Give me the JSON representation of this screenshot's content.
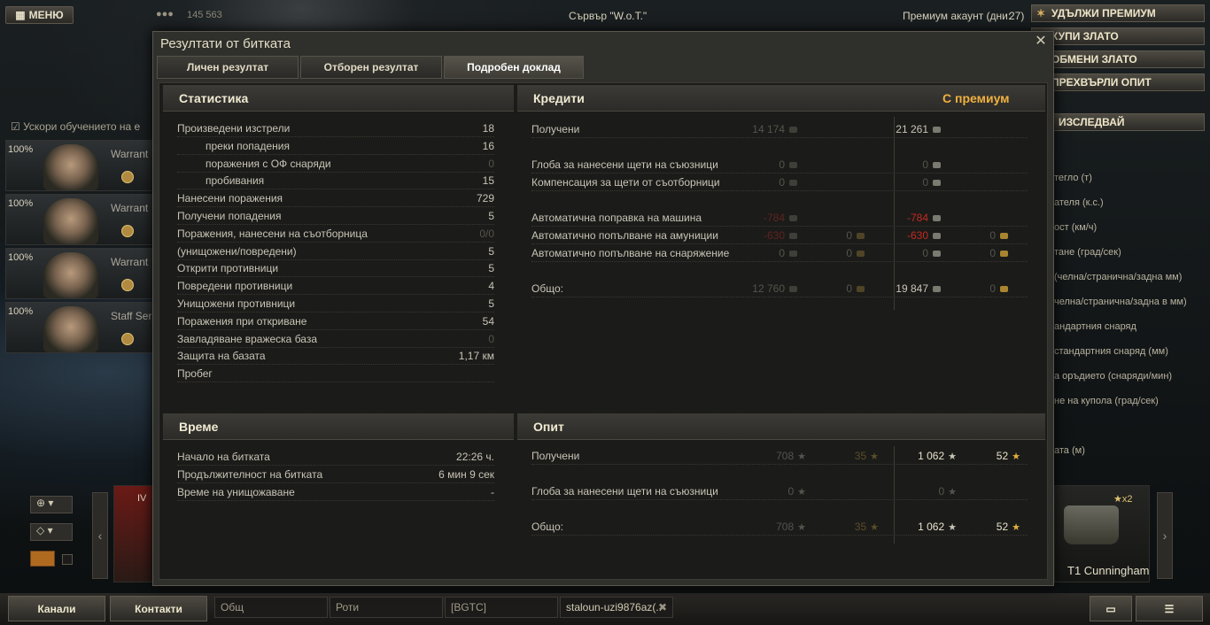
{
  "topbar": {
    "menu": "МЕНЮ",
    "player_count": "145 563",
    "server": "Сървър \"W.o.T.\"",
    "premium_label": "Премиум акаунт (дни:",
    "premium_days": "27)",
    "right_buttons": [
      "УДЪЛЖИ ПРЕМИУМ",
      "КУПИ ЗЛАТО",
      "ОБМЕНИ ЗЛАТО",
      "ПРЕХВЪРЛИ ОПИТ"
    ]
  },
  "left": {
    "accelerate": "Ускори обучението на е",
    "crew": [
      {
        "pct": "100%",
        "rank": "Warrant"
      },
      {
        "pct": "100%",
        "rank": "Warrant"
      },
      {
        "pct": "100%",
        "rank": "Warrant"
      },
      {
        "pct": "100%",
        "rank": "Staff Ser"
      }
    ]
  },
  "right": {
    "research": "ИЗСЛЕДВАЙ",
    "stats": [
      "тегло (т)",
      "ателя (к.с.)",
      "ост (км/ч)",
      "тане (град/сек)",
      "(челна/странична/задна мм)",
      "челна/странична/задна в мм)",
      "андартния снаряд",
      "стандартния снаряд (мм)",
      "а оръдието (снаряди/мин)",
      "не на купола (град/сек)",
      "ата (м)"
    ]
  },
  "carousel": {
    "tier": "IV",
    "tank_name": "T1 Cunningham",
    "multiplier": "x2"
  },
  "bottombar": {
    "channels": "Канали",
    "contacts": "Контакти",
    "chats": [
      "Общ",
      "Роти",
      "[BGTC]",
      "staloun-uzi9876az(.."
    ]
  },
  "dialog": {
    "title": "Резултати от битката",
    "tabs": [
      "Личен резултат",
      "Отборен резултат",
      "Подробен доклад"
    ],
    "stats": {
      "header": "Статистика",
      "rows": [
        {
          "label": "Произведени изстрели",
          "value": "18"
        },
        {
          "label": "преки попадения",
          "value": "16",
          "indent": true
        },
        {
          "label": "поражения с ОФ снаряди",
          "value": "0",
          "indent": true,
          "dim": true
        },
        {
          "label": "пробивания",
          "value": "15",
          "indent": true
        },
        {
          "label": "Нанесени поражения",
          "value": "729"
        },
        {
          "label": "Получени попадения",
          "value": "5"
        },
        {
          "label": "Поражения, нанесени на съотборница",
          "value": "0/0",
          "dim": true
        },
        {
          "label": "(унищожени/повредени)",
          "value": "5"
        },
        {
          "label": "Открити противници",
          "value": "5"
        },
        {
          "label": "Повредени противници",
          "value": "4"
        },
        {
          "label": "Унищожени противници",
          "value": "5"
        },
        {
          "label": "Поражения при откриване",
          "value": "54"
        },
        {
          "label": "Завладяване вражеска база",
          "value": "0",
          "dim": true
        },
        {
          "label": "Защита на базата",
          "value": "1,17 км"
        },
        {
          "label": "Пробег",
          "value": ""
        }
      ]
    },
    "time": {
      "header": "Време",
      "rows": [
        {
          "label": "Начало на битката",
          "value": "22:26 ч."
        },
        {
          "label": "Продължителност на битката",
          "value": "6 мин 9 сек"
        },
        {
          "label": "Време на унищожаване",
          "value": "-"
        }
      ]
    },
    "credits": {
      "header": "Кредити",
      "premium_header": "С премиум",
      "rows": [
        {
          "label": "Получени",
          "base": "14 174",
          "base_gold": "",
          "prem": "21 261",
          "prem_gold": ""
        },
        {
          "label": "Глоба за нанесени щети на съюзници",
          "base": "0",
          "base_gold": "",
          "prem": "0",
          "prem_gold": ""
        },
        {
          "label": "Компенсация за щети от съотборници",
          "base": "0",
          "base_gold": "",
          "prem": "0",
          "prem_gold": ""
        },
        {
          "label": "Автоматична поправка на машина",
          "base": "-784",
          "base_gold": "",
          "prem": "-784",
          "prem_gold": ""
        },
        {
          "label": "Автоматично попълване на амуниции",
          "base": "-630",
          "base_gold": "0",
          "prem": "-630",
          "prem_gold": "0"
        },
        {
          "label": "Автоматично попълване на снаряжение",
          "base": "0",
          "base_gold": "0",
          "prem": "0",
          "prem_gold": "0"
        },
        {
          "label": "Общо:",
          "base": "12 760",
          "base_gold": "0",
          "prem": "19 847",
          "prem_gold": "0"
        }
      ]
    },
    "xp": {
      "header": "Опит",
      "rows": [
        {
          "label": "Получени",
          "base": "708",
          "base_free": "35",
          "prem": "1 062",
          "prem_free": "52"
        },
        {
          "label": "Глоба за нанесени щети на съюзници",
          "base": "0",
          "base_free": "",
          "prem": "0",
          "prem_free": ""
        },
        {
          "label": "Общо:",
          "base": "708",
          "base_free": "35",
          "prem": "1 062",
          "prem_free": "52"
        }
      ]
    }
  },
  "colors": {
    "gold": "#f0b040",
    "negative": "#c22a22",
    "premium_header": "#f0b040"
  }
}
